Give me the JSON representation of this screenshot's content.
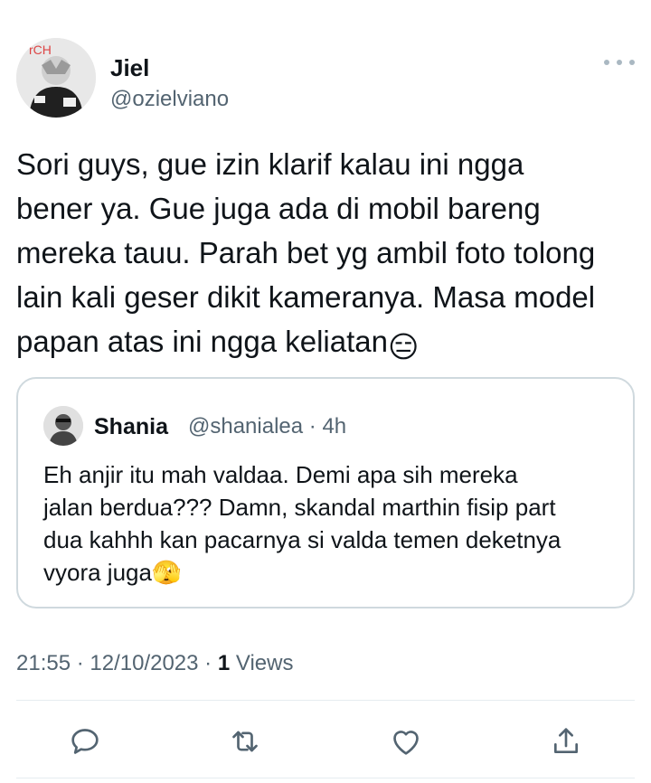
{
  "author": {
    "name": "Jiel",
    "handle": "@ozielviano",
    "avatar_icon": "user-avatar-photo"
  },
  "tweet": {
    "text": "Sori guys, gue izin klarif kalau ini ngga\nbener ya. Gue juga ada di mobil bareng\nmereka tauu. Parah bet yg ambil foto tolong\nlain kali geser dikit kameranya. Masa model\npapan atas ini ngga keliatan",
    "emoji": "😑"
  },
  "quoted": {
    "name": "Shania",
    "handle_time": "@shanialea · 4h",
    "text": "Eh anjir itu mah valdaa. Demi apa sih mereka\njalan berdua??? Damn, skandal marthin fisip part\ndua kahhh kan pacarnya si valda temen deketnya\nvyora juga",
    "emoji": "🫣"
  },
  "meta": {
    "time_date": "21:55 · 12/10/2023 · ",
    "views_count": "1",
    "views_label": " Views"
  },
  "actions": {
    "icons": [
      "reply-icon",
      "retweet-icon",
      "like-icon",
      "share-icon"
    ]
  },
  "colors": {
    "text": "#0f1419",
    "secondary": "#536471",
    "border": "#cfd9de",
    "icon": "#536471"
  }
}
